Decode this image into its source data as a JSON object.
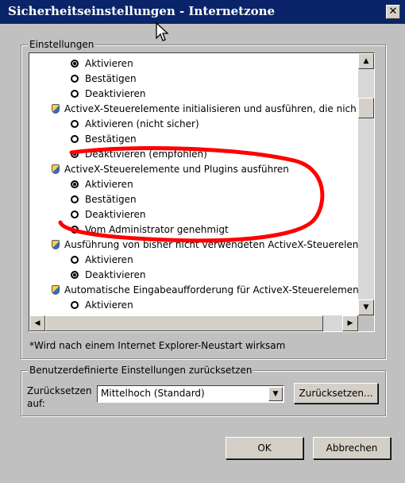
{
  "window": {
    "title": "Sicherheitseinstellungen - Internetzone",
    "close_symbol": "✕"
  },
  "settings_group": {
    "label": "Einstellungen"
  },
  "settings_list": [
    {
      "type": "option",
      "label": "Aktivieren",
      "checked": true
    },
    {
      "type": "option",
      "label": "Bestätigen",
      "checked": false
    },
    {
      "type": "option",
      "label": "Deaktivieren",
      "checked": false
    },
    {
      "type": "header",
      "label": "ActiveX-Steuerelemente initialisieren und ausführen, die nich"
    },
    {
      "type": "option",
      "label": "Aktivieren (nicht sicher)",
      "checked": false
    },
    {
      "type": "option",
      "label": "Bestätigen",
      "checked": false
    },
    {
      "type": "option",
      "label": "Deaktivieren (empfohlen)",
      "checked": true
    },
    {
      "type": "header",
      "label": "ActiveX-Steuerelemente und Plugins ausführen"
    },
    {
      "type": "option",
      "label": "Aktivieren",
      "checked": true
    },
    {
      "type": "option",
      "label": "Bestätigen",
      "checked": false
    },
    {
      "type": "option",
      "label": "Deaktivieren",
      "checked": false
    },
    {
      "type": "option",
      "label": "Vom Administrator genehmigt",
      "checked": false
    },
    {
      "type": "header",
      "label": "Ausführung von bisher nicht verwendeten ActiveX-Steuerelen"
    },
    {
      "type": "option",
      "label": "Aktivieren",
      "checked": false
    },
    {
      "type": "option",
      "label": "Deaktivieren",
      "checked": true
    },
    {
      "type": "header",
      "label": "Automatische Eingabeaufforderung für ActiveX-Steuerelemen"
    },
    {
      "type": "option",
      "label": "Aktivieren",
      "checked": false
    }
  ],
  "restart_note": "*Wird nach einem Internet Explorer-Neustart wirksam",
  "reset_group": {
    "label": "Benutzerdefinierte Einstellungen zurücksetzen",
    "reset_to_label_line1": "Zurücksetzen",
    "reset_to_label_line2": "auf:",
    "dropdown_value": "Mittelhoch (Standard)",
    "reset_button": "Zurücksetzen..."
  },
  "buttons": {
    "ok": "OK",
    "cancel": "Abbrechen"
  },
  "colors": {
    "titlebar": "#0a246a",
    "annotation": "#ff0000",
    "dialog_bg": "#c0c0c0"
  }
}
